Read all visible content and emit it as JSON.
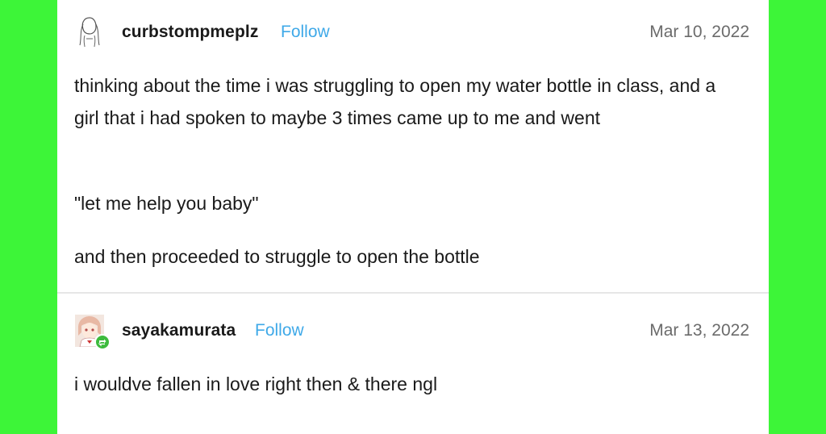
{
  "posts": [
    {
      "username": "curbstompmeplz",
      "follow_label": "Follow",
      "date": "Mar 10, 2022",
      "paragraphs": [
        "thinking about the time i was struggling to open my water bottle in class, and a girl that i had spoken to maybe 3 times came up to me and went",
        "\"let me help you baby\"",
        "and then proceeded to struggle to open the bottle"
      ],
      "avatar_icon": "sketch-character-avatar"
    },
    {
      "username": "sayakamurata",
      "follow_label": "Follow",
      "date": "Mar 13, 2022",
      "paragraphs": [
        "i wouldve fallen in love right then & there ngl"
      ],
      "avatar_icon": "anime-character-avatar",
      "badge_icon": "reblog-icon"
    }
  ],
  "colors": {
    "background": "#3df538",
    "card": "#ffffff",
    "follow": "#3fa9e8",
    "date": "#6b6b6b",
    "text": "#1a1a1a",
    "badge": "#3dbb3d"
  }
}
